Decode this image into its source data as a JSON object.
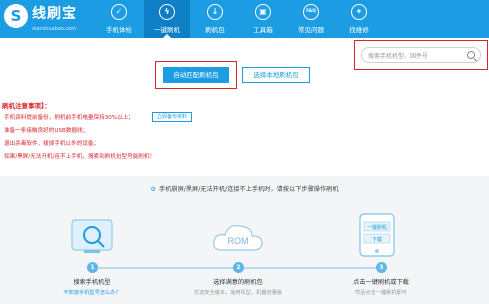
{
  "brand": {
    "name": "线刷宝",
    "domain": "xianshuabao.com"
  },
  "nav": {
    "items": [
      {
        "label": "手机体检",
        "icon": "phone-check-icon"
      },
      {
        "label": "一键刷机",
        "icon": "lightning-icon",
        "active": true
      },
      {
        "label": "刷机包",
        "icon": "package-icon"
      },
      {
        "label": "工具箱",
        "icon": "toolbox-icon"
      },
      {
        "label": "常见问题",
        "icon": "faq-icon"
      },
      {
        "label": "找维修",
        "icon": "repair-icon"
      }
    ],
    "faq_glyph": "FAQ"
  },
  "search": {
    "placeholder": "搜索手机机型、固件号"
  },
  "actions": {
    "auto_match": "自动匹配刷机包",
    "local_select": "选择本地刷机包"
  },
  "notes": {
    "title": "刷机注意事项】：",
    "items": [
      "手机资料提前备份，刷机前手机电量保持30%以上；",
      "准备一条接触良好的USB数据线；",
      "退出杀毒软件，拔掉手机以外的设备；",
      "如果/黑屏/无法开机/连不上手机，搜索到刷机包型号能刷机！"
    ],
    "backup_button": "立即备份资料"
  },
  "guide": {
    "title": "手机崩屏/黑屏/无法开机/连接不上手机时，请按以下步骤操作刷机",
    "steps": [
      {
        "num": "1",
        "title": "搜索手机机型",
        "sub": "不知道手机型号怎么办？"
      },
      {
        "num": "2",
        "title": "选择满意的刷机包",
        "sub": "优选安全版本，适用机型，机器容量版"
      },
      {
        "num": "3",
        "title": "点击一键刷机或下载",
        "sub": "然后点击一键刷机即可"
      }
    ],
    "rom_label": "ROM",
    "flash_label": "一键刷机",
    "download_label": "下载"
  },
  "colors": {
    "primary": "#1c9de3",
    "highlight": "#d8262c",
    "guide_bg": "#f3f5f7"
  }
}
